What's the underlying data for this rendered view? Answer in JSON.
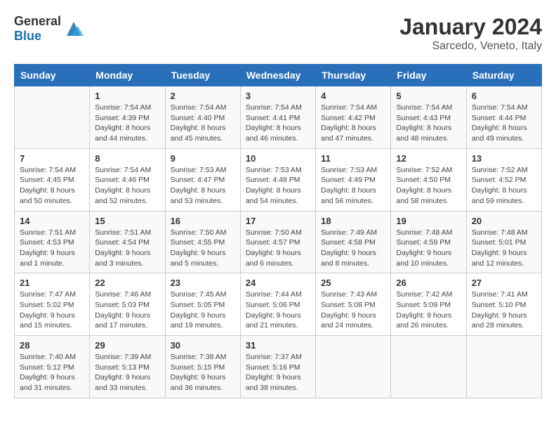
{
  "header": {
    "logo_general": "General",
    "logo_blue": "Blue",
    "month_title": "January 2024",
    "location": "Sarcedo, Veneto, Italy"
  },
  "days_of_week": [
    "Sunday",
    "Monday",
    "Tuesday",
    "Wednesday",
    "Thursday",
    "Friday",
    "Saturday"
  ],
  "weeks": [
    [
      {
        "day": "",
        "info": ""
      },
      {
        "day": "1",
        "info": "Sunrise: 7:54 AM\nSunset: 4:39 PM\nDaylight: 8 hours\nand 44 minutes."
      },
      {
        "day": "2",
        "info": "Sunrise: 7:54 AM\nSunset: 4:40 PM\nDaylight: 8 hours\nand 45 minutes."
      },
      {
        "day": "3",
        "info": "Sunrise: 7:54 AM\nSunset: 4:41 PM\nDaylight: 8 hours\nand 46 minutes."
      },
      {
        "day": "4",
        "info": "Sunrise: 7:54 AM\nSunset: 4:42 PM\nDaylight: 8 hours\nand 47 minutes."
      },
      {
        "day": "5",
        "info": "Sunrise: 7:54 AM\nSunset: 4:43 PM\nDaylight: 8 hours\nand 48 minutes."
      },
      {
        "day": "6",
        "info": "Sunrise: 7:54 AM\nSunset: 4:44 PM\nDaylight: 8 hours\nand 49 minutes."
      }
    ],
    [
      {
        "day": "7",
        "info": "Sunrise: 7:54 AM\nSunset: 4:45 PM\nDaylight: 8 hours\nand 50 minutes."
      },
      {
        "day": "8",
        "info": "Sunrise: 7:54 AM\nSunset: 4:46 PM\nDaylight: 8 hours\nand 52 minutes."
      },
      {
        "day": "9",
        "info": "Sunrise: 7:53 AM\nSunset: 4:47 PM\nDaylight: 8 hours\nand 53 minutes."
      },
      {
        "day": "10",
        "info": "Sunrise: 7:53 AM\nSunset: 4:48 PM\nDaylight: 8 hours\nand 54 minutes."
      },
      {
        "day": "11",
        "info": "Sunrise: 7:53 AM\nSunset: 4:49 PM\nDaylight: 8 hours\nand 56 minutes."
      },
      {
        "day": "12",
        "info": "Sunrise: 7:52 AM\nSunset: 4:50 PM\nDaylight: 8 hours\nand 58 minutes."
      },
      {
        "day": "13",
        "info": "Sunrise: 7:52 AM\nSunset: 4:52 PM\nDaylight: 8 hours\nand 59 minutes."
      }
    ],
    [
      {
        "day": "14",
        "info": "Sunrise: 7:51 AM\nSunset: 4:53 PM\nDaylight: 9 hours\nand 1 minute."
      },
      {
        "day": "15",
        "info": "Sunrise: 7:51 AM\nSunset: 4:54 PM\nDaylight: 9 hours\nand 3 minutes."
      },
      {
        "day": "16",
        "info": "Sunrise: 7:50 AM\nSunset: 4:55 PM\nDaylight: 9 hours\nand 5 minutes."
      },
      {
        "day": "17",
        "info": "Sunrise: 7:50 AM\nSunset: 4:57 PM\nDaylight: 9 hours\nand 6 minutes."
      },
      {
        "day": "18",
        "info": "Sunrise: 7:49 AM\nSunset: 4:58 PM\nDaylight: 9 hours\nand 8 minutes."
      },
      {
        "day": "19",
        "info": "Sunrise: 7:48 AM\nSunset: 4:59 PM\nDaylight: 9 hours\nand 10 minutes."
      },
      {
        "day": "20",
        "info": "Sunrise: 7:48 AM\nSunset: 5:01 PM\nDaylight: 9 hours\nand 12 minutes."
      }
    ],
    [
      {
        "day": "21",
        "info": "Sunrise: 7:47 AM\nSunset: 5:02 PM\nDaylight: 9 hours\nand 15 minutes."
      },
      {
        "day": "22",
        "info": "Sunrise: 7:46 AM\nSunset: 5:03 PM\nDaylight: 9 hours\nand 17 minutes."
      },
      {
        "day": "23",
        "info": "Sunrise: 7:45 AM\nSunset: 5:05 PM\nDaylight: 9 hours\nand 19 minutes."
      },
      {
        "day": "24",
        "info": "Sunrise: 7:44 AM\nSunset: 5:06 PM\nDaylight: 9 hours\nand 21 minutes."
      },
      {
        "day": "25",
        "info": "Sunrise: 7:43 AM\nSunset: 5:08 PM\nDaylight: 9 hours\nand 24 minutes."
      },
      {
        "day": "26",
        "info": "Sunrise: 7:42 AM\nSunset: 5:09 PM\nDaylight: 9 hours\nand 26 minutes."
      },
      {
        "day": "27",
        "info": "Sunrise: 7:41 AM\nSunset: 5:10 PM\nDaylight: 9 hours\nand 28 minutes."
      }
    ],
    [
      {
        "day": "28",
        "info": "Sunrise: 7:40 AM\nSunset: 5:12 PM\nDaylight: 9 hours\nand 31 minutes."
      },
      {
        "day": "29",
        "info": "Sunrise: 7:39 AM\nSunset: 5:13 PM\nDaylight: 9 hours\nand 33 minutes."
      },
      {
        "day": "30",
        "info": "Sunrise: 7:38 AM\nSunset: 5:15 PM\nDaylight: 9 hours\nand 36 minutes."
      },
      {
        "day": "31",
        "info": "Sunrise: 7:37 AM\nSunset: 5:16 PM\nDaylight: 9 hours\nand 38 minutes."
      },
      {
        "day": "",
        "info": ""
      },
      {
        "day": "",
        "info": ""
      },
      {
        "day": "",
        "info": ""
      }
    ]
  ]
}
